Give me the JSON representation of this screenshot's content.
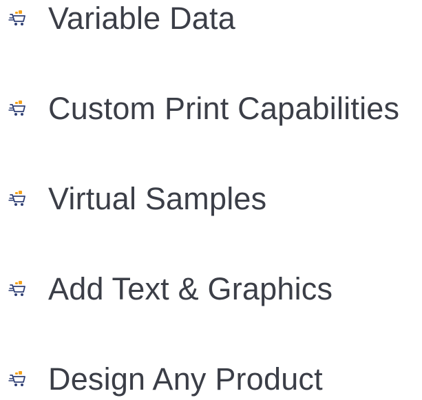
{
  "features": {
    "items": [
      {
        "label": "Variable Data",
        "icon": "shopping-cart-icon"
      },
      {
        "label": "Custom Print Capabilities",
        "icon": "shopping-cart-icon"
      },
      {
        "label": "Virtual Samples",
        "icon": "shopping-cart-icon"
      },
      {
        "label": "Add Text & Graphics",
        "icon": "shopping-cart-icon"
      },
      {
        "label": "Design Any Product",
        "icon": "shopping-cart-icon"
      }
    ]
  },
  "colors": {
    "text": "#3b3e47",
    "icon_cart": "#2f3f74",
    "icon_accent": "#f2a21c"
  }
}
